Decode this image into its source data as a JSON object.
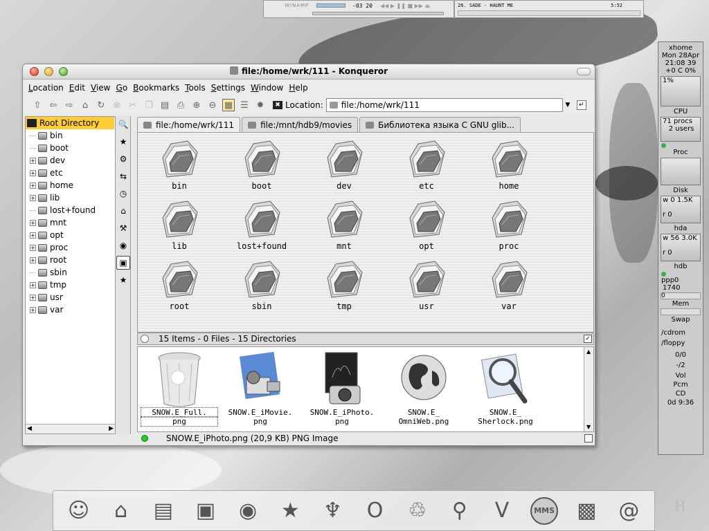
{
  "winamp": {
    "title": "WINAMP",
    "time": "-03 20",
    "track": "26. SADE - HAUNT ME",
    "length": "5:52"
  },
  "window": {
    "title": "file:/home/wrk/111 - Konqueror"
  },
  "menu": [
    "Location",
    "Edit",
    "View",
    "Go",
    "Bookmarks",
    "Tools",
    "Settings",
    "Window",
    "Help"
  ],
  "location": {
    "label": "Location:",
    "url": "file:/home/wrk/111"
  },
  "tree": {
    "root": "Root Directory",
    "items": [
      {
        "name": "bin",
        "expandable": false
      },
      {
        "name": "boot",
        "expandable": false
      },
      {
        "name": "dev",
        "expandable": true
      },
      {
        "name": "etc",
        "expandable": true
      },
      {
        "name": "home",
        "expandable": true
      },
      {
        "name": "lib",
        "expandable": true
      },
      {
        "name": "lost+found",
        "expandable": false
      },
      {
        "name": "mnt",
        "expandable": true
      },
      {
        "name": "opt",
        "expandable": true
      },
      {
        "name": "proc",
        "expandable": true
      },
      {
        "name": "root",
        "expandable": true
      },
      {
        "name": "sbin",
        "expandable": false
      },
      {
        "name": "tmp",
        "expandable": true
      },
      {
        "name": "usr",
        "expandable": true
      },
      {
        "name": "var",
        "expandable": true
      }
    ]
  },
  "tabs": [
    {
      "label": "file:/home/wrk/111",
      "active": true
    },
    {
      "label": "file:/mnt/hdb9/movies",
      "active": false
    },
    {
      "label": "Библиотека языка C GNU glib...",
      "active": false
    }
  ],
  "folders": [
    "bin",
    "boot",
    "dev",
    "etc",
    "home",
    "lib",
    "lost+found",
    "mnt",
    "opt",
    "proc",
    "root",
    "sbin",
    "tmp",
    "usr",
    "var"
  ],
  "status_top": "15 Items - 0 Files - 15 Directories",
  "preview_files": [
    {
      "line1": "SNOW.E_Full.",
      "line2": "png"
    },
    {
      "line1": "SNOW.E_iMovie.",
      "line2": "png"
    },
    {
      "line1": "SNOW.E_iPhoto.",
      "line2": "png"
    },
    {
      "line1": "SNOW.E_",
      "line2": "OmniWeb.png"
    },
    {
      "line1": "SNOW.E_",
      "line2": "Sherlock.png"
    }
  ],
  "status_bottom": "SNOW.E_iPhoto.png (20,9 KB)  PNG Image",
  "gkrellm": {
    "host": "xhome",
    "date": "Mon 28Apr",
    "time": "21:08 39",
    "temp": "+0  C  0%",
    "cpu_pct": "1%",
    "cpu": "CPU",
    "procs": "71 procs",
    "users": "2 users",
    "proc": "Proc",
    "disk": "Disk",
    "disk_w": "w 0",
    "disk_wv": "1.5K",
    "disk_r": "r  0",
    "hda": "hda",
    "hda_w": "w 56 3.0K",
    "hda_r": "r  0",
    "hdb": "hdb",
    "ppp": "ppp0",
    "ppp_val": "1740",
    "ppp_zero": "0",
    "mem": "Mem",
    "swap": "Swap",
    "cdrom": "/cdrom",
    "floppy": "/floppy",
    "mail1": "0/0",
    "mail2": "-/2",
    "vol": "Vol",
    "pcm": "Pcm",
    "cd": "CD",
    "uptime": "0d  9:36"
  },
  "dock": [
    "finder-icon",
    "network-icon",
    "terminal-icon",
    "imovie-icon",
    "globe-icon",
    "star-icon",
    "phoenix-icon",
    "opera-icon",
    "trash-icon",
    "sherlock-icon",
    "vim-icon",
    "mms-icon",
    "iphoto-icon",
    "addressbook-icon"
  ],
  "dock_mms": "MMS",
  "dock_h": "H"
}
